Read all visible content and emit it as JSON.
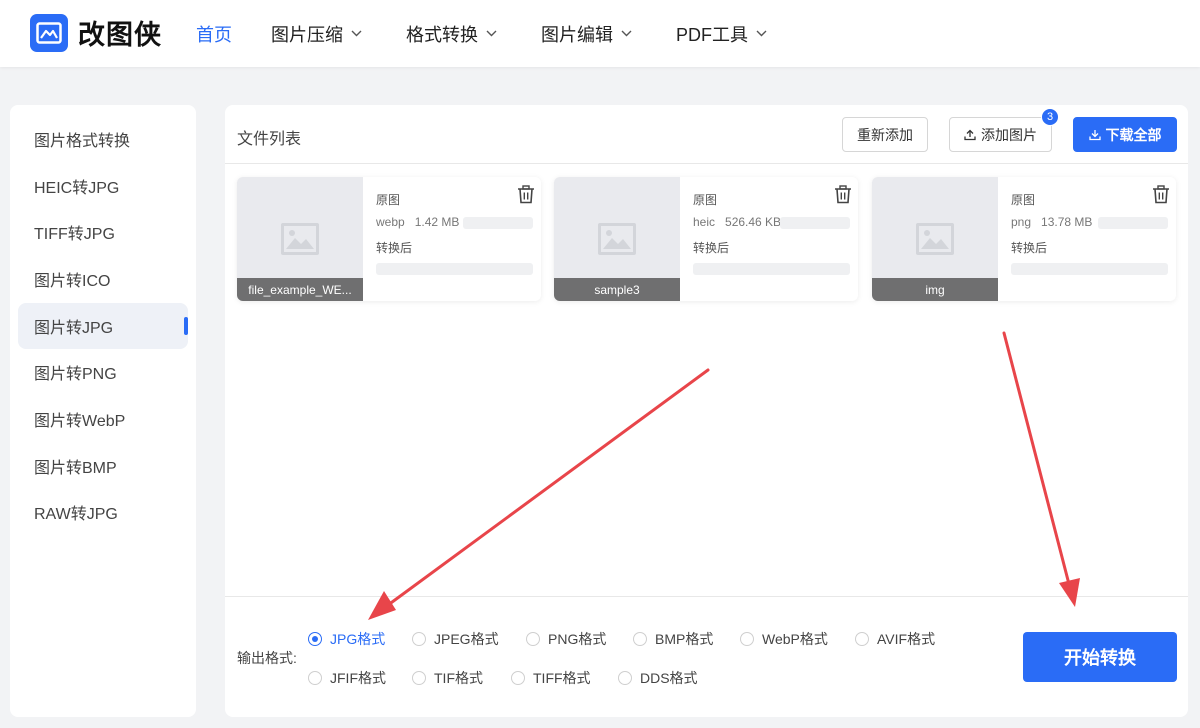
{
  "app": {
    "logo_text": "改图侠"
  },
  "nav": [
    {
      "label": "首页",
      "active": true,
      "has_dropdown": false
    },
    {
      "label": "图片压缩",
      "active": false,
      "has_dropdown": true
    },
    {
      "label": "格式转换",
      "active": false,
      "has_dropdown": true
    },
    {
      "label": "图片编辑",
      "active": false,
      "has_dropdown": true
    },
    {
      "label": "PDF工具",
      "active": false,
      "has_dropdown": true
    }
  ],
  "sidebar": {
    "items": [
      {
        "label": "图片格式转换",
        "active": false
      },
      {
        "label": "HEIC转JPG",
        "active": false
      },
      {
        "label": "TIFF转JPG",
        "active": false
      },
      {
        "label": "图片转ICO",
        "active": false
      },
      {
        "label": "图片转JPG",
        "active": true
      },
      {
        "label": "图片转PNG",
        "active": false
      },
      {
        "label": "图片转WebP",
        "active": false
      },
      {
        "label": "图片转BMP",
        "active": false
      },
      {
        "label": "RAW转JPG",
        "active": false
      }
    ]
  },
  "main": {
    "title": "文件列表",
    "readd_label": "重新添加",
    "add_label": "添加图片",
    "add_badge": "3",
    "download_label": "下载全部"
  },
  "files": [
    {
      "name": "file_example_WE...",
      "orig_label": "原图",
      "format": "webp",
      "size": "1.42 MB",
      "after_label": "转换后"
    },
    {
      "name": "sample3",
      "orig_label": "原图",
      "format": "heic",
      "size": "526.46 KB",
      "after_label": "转换后"
    },
    {
      "name": "img",
      "orig_label": "原图",
      "format": "png",
      "size": "13.78 MB",
      "after_label": "转换后"
    }
  ],
  "output": {
    "label": "输出格式:",
    "selected": "JPG格式",
    "options": [
      "JPG格式",
      "JPEG格式",
      "PNG格式",
      "BMP格式",
      "WebP格式",
      "AVIF格式",
      "JFIF格式",
      "TIF格式",
      "TIFF格式",
      "DDS格式"
    ]
  },
  "start_label": "开始转换",
  "colors": {
    "accent": "#2a6cf6",
    "arrow": "#e8454a"
  }
}
